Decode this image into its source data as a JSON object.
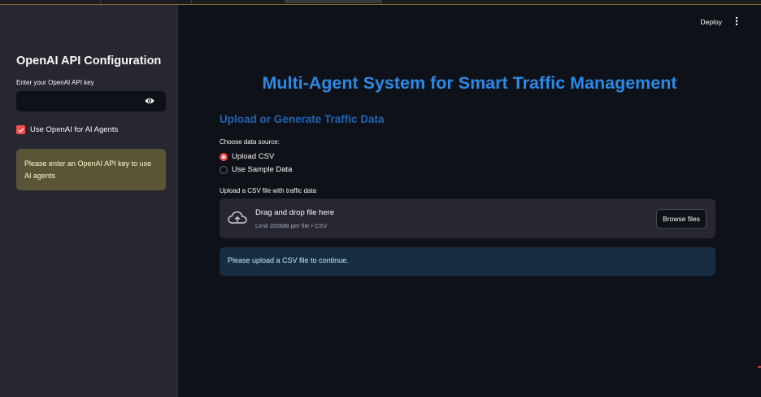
{
  "sidebar": {
    "title": "OpenAI API Configuration",
    "api_key_label": "Enter your OpenAI API key",
    "api_key_value": "",
    "use_openai_label": "Use OpenAI for AI Agents",
    "use_openai_checked": true,
    "warning": "Please enter an OpenAI API key to use AI agents"
  },
  "header": {
    "deploy_label": "Deploy",
    "menu_icon": "kebab-menu-icon"
  },
  "main": {
    "title": "Multi-Agent System for Smart Traffic Management",
    "section_title": "Upload or Generate Traffic Data",
    "data_source_label": "Choose data source:",
    "data_source_options": [
      "Upload CSV",
      "Use Sample Data"
    ],
    "data_source_selected": "Upload CSV",
    "upload_label": "Upload a CSV file with traffic data",
    "dropzone_title": "Drag and drop file here",
    "dropzone_sub": "Limit 200MB per file • CSV",
    "browse_label": "Browse files",
    "info_message": "Please upload a CSV file to continue."
  },
  "colors": {
    "accent": "#ff4b4b",
    "title_blue": "#2b8ae8",
    "section_blue": "#1e63b8",
    "warning_bg": "#5b5537",
    "info_bg": "#172d43"
  }
}
